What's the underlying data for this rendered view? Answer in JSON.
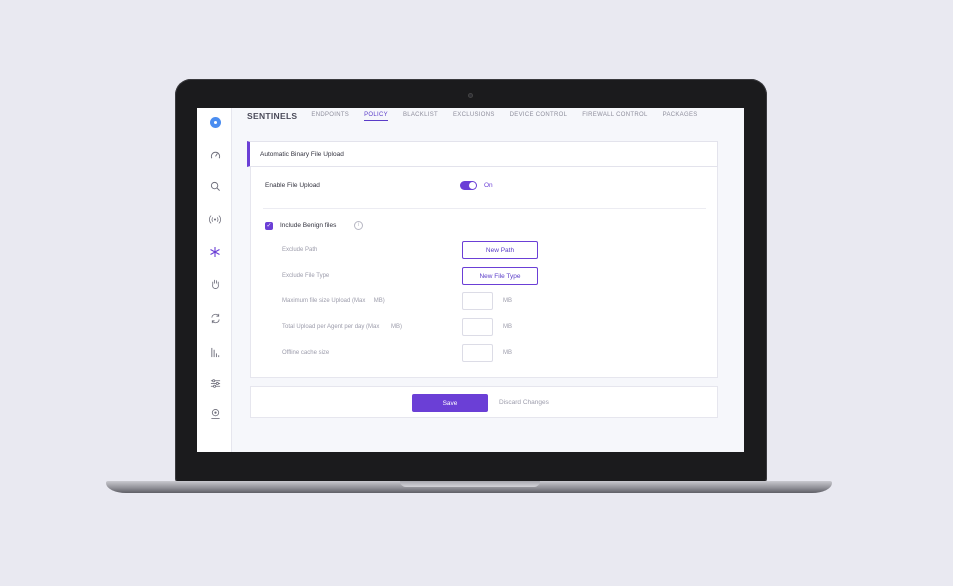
{
  "nav": {
    "title": "SENTINELS",
    "tabs": [
      {
        "label": "ENDPOINTS",
        "active": false
      },
      {
        "label": "POLICY",
        "active": true
      },
      {
        "label": "BLACKLIST",
        "active": false
      },
      {
        "label": "EXCLUSIONS",
        "active": false
      },
      {
        "label": "DEVICE CONTROL",
        "active": false
      },
      {
        "label": "FIREWALL CONTROL",
        "active": false
      },
      {
        "label": "PACKAGES",
        "active": false
      }
    ]
  },
  "sidebar": {
    "icons": [
      "logo-icon",
      "dashboard-icon",
      "search-icon",
      "broadcast-icon",
      "sentinels-icon",
      "hand-icon",
      "sync-icon",
      "analytics-icon",
      "settings-icon",
      "user-icon"
    ]
  },
  "section": {
    "title": "Automatic Binary File Upload"
  },
  "enable_upload": {
    "label": "Enable File Upload",
    "state_label": "On",
    "enabled": true
  },
  "include_benign": {
    "label": "Include Benign files",
    "checked": true,
    "info_glyph": "i"
  },
  "exclude_path": {
    "label": "Exclude Path",
    "button": "New Path"
  },
  "exclude_file_type": {
    "label": "Exclude File Type",
    "button": "New File Type"
  },
  "max_file_size": {
    "label": "Maximum file size Upload (Max     MB)",
    "unit": "MB",
    "value": ""
  },
  "total_upload": {
    "label": "Total Upload per Agent per day (Max       MB)",
    "unit": "MB",
    "value": ""
  },
  "offline_cache": {
    "label": "Offline cache size",
    "unit": "MB",
    "value": ""
  },
  "footer": {
    "save_label": "Save",
    "discard_label": "Discard Changes"
  },
  "colors": {
    "accent": "#6b3fd6",
    "background": "#e9e9f1",
    "screen": "#f6f7fb"
  }
}
